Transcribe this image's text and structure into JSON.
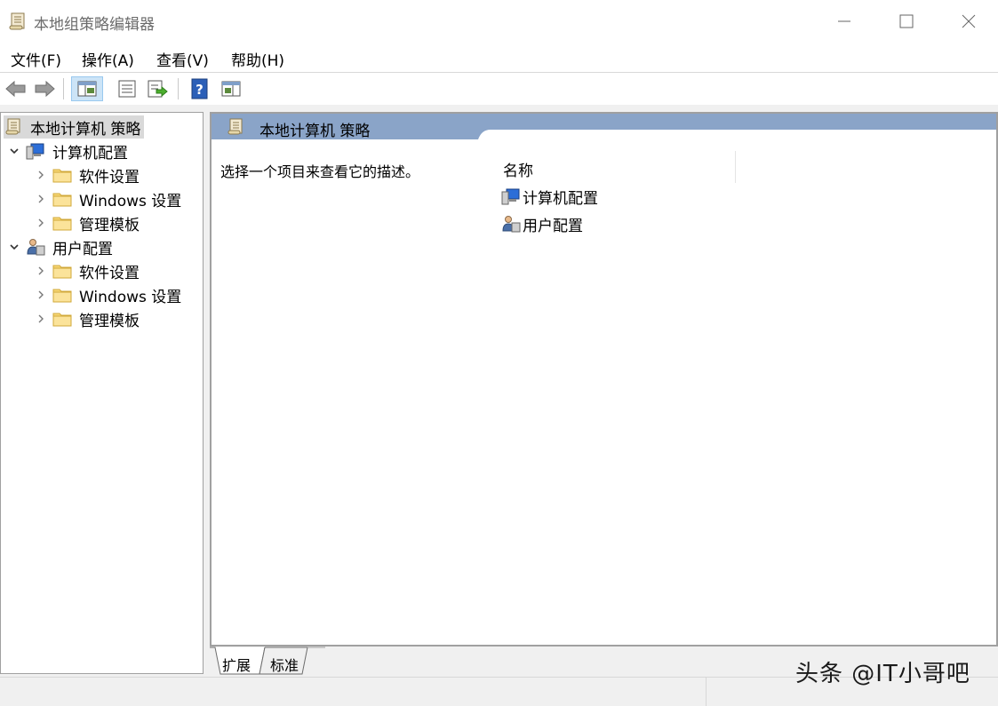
{
  "window": {
    "title": "本地组策略编辑器"
  },
  "menu": [
    "文件(F)",
    "操作(A)",
    "查看(V)",
    "帮助(H)"
  ],
  "tree": {
    "root": "本地计算机 策略",
    "computer_config": {
      "label": "计算机配置",
      "children": [
        "软件设置",
        "Windows 设置",
        "管理模板"
      ]
    },
    "user_config": {
      "label": "用户配置",
      "children": [
        "软件设置",
        "Windows 设置",
        "管理模板"
      ]
    }
  },
  "right_panel": {
    "header": "本地计算机 策略",
    "description": "选择一个项目来查看它的描述。",
    "column_name": "名称",
    "items": [
      "计算机配置",
      "用户配置"
    ]
  },
  "tabs": [
    "扩展",
    "标准"
  ],
  "watermark": "头条 @IT小哥吧",
  "icons": {
    "back": "back-arrow-icon",
    "forward": "forward-arrow-icon",
    "show-tree": "console-tree-icon",
    "properties": "properties-icon",
    "export": "export-list-icon",
    "help": "help-icon",
    "view": "view-icon",
    "policy": "policy-scroll-icon",
    "computer": "computer-config-icon",
    "user": "user-config-icon",
    "folder": "folder-icon"
  },
  "colors": {
    "header": "#8aa4c8",
    "selected_tool": "#cce4f7",
    "folder": "#f8d775"
  }
}
